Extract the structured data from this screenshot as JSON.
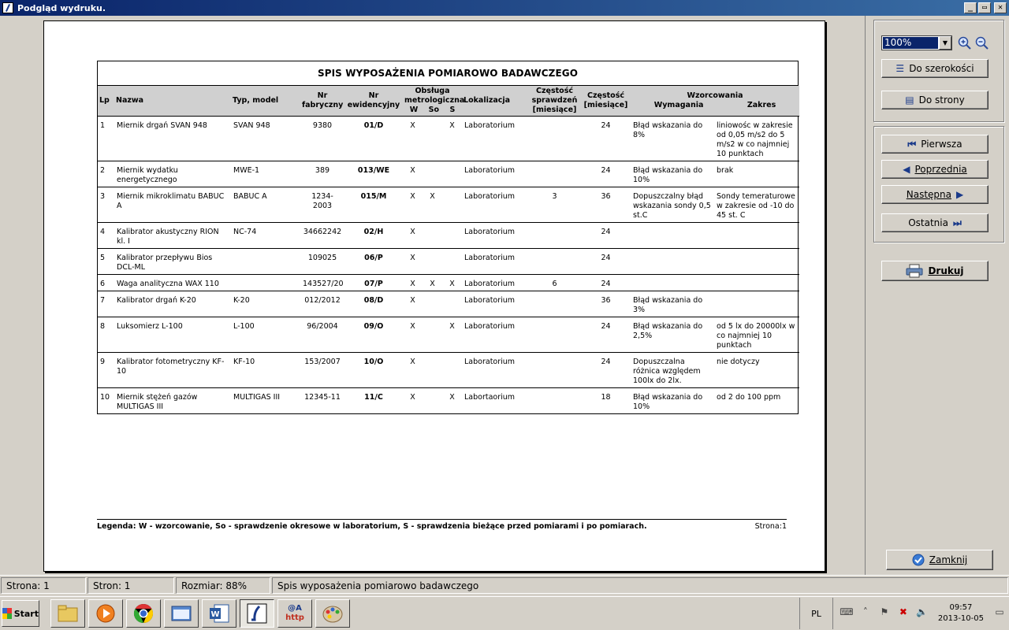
{
  "window": {
    "title": "Podgląd wydruku.",
    "buttons": [
      "_",
      "▭",
      "✕"
    ]
  },
  "report": {
    "title": "SPIS WYPOSAŻENIA POMIAROWO BADAWCZEGO",
    "headers": {
      "lp": "Lp",
      "nazwa": "Nazwa",
      "typ": "Typ, model",
      "nr_fab": "Nr fabryczny",
      "nr_ewid": "Nr ewidencyjny",
      "obsluga": "Obsługa metrologiczna",
      "obs_w": "W",
      "obs_so": "So",
      "obs_s": "S",
      "lokalizacja": "Lokalizacja",
      "czest_spr": "Częstość sprawdzeń [miesiące]",
      "czest": "Częstość [miesiące]",
      "wzorcowania": "Wzorcowania",
      "wymagania": "Wymagania",
      "zakres": "Zakres"
    },
    "rows": [
      {
        "lp": "1",
        "nazwa": "Miernik drgań SVAN 948",
        "typ": "SVAN 948",
        "nr_fab": "9380",
        "nr_ewid": "01/D",
        "w": "X",
        "so": "",
        "s": "X",
        "lok": "Laboratorium",
        "czest_spr": "",
        "czest": "24",
        "wym": "Błąd wskazania do 8%",
        "zakres": "liniowośc w zakresie od 0,05 m/s2 do 5 m/s2 w co najmniej 10 punktach"
      },
      {
        "lp": "2",
        "nazwa": "Miernik wydatku energetycznego",
        "typ": "MWE-1",
        "nr_fab": "389",
        "nr_ewid": "013/WE",
        "w": "X",
        "so": "",
        "s": "",
        "lok": "Laboratorium",
        "czest_spr": "",
        "czest": "24",
        "wym": "Błąd wskazania do 10%",
        "zakres": "brak"
      },
      {
        "lp": "3",
        "nazwa": "Miernik mikroklimatu BABUC A",
        "typ": "BABUC A",
        "nr_fab": "1234-2003",
        "nr_ewid": "015/M",
        "w": "X",
        "so": "X",
        "s": "",
        "lok": "Laboratorium",
        "czest_spr": "3",
        "czest": "36",
        "wym": "Dopuszczalny błąd wskazania sondy 0,5 st.C",
        "zakres": "Sondy temeraturowe w zakresie od -10 do 45 st. C"
      },
      {
        "lp": "4",
        "nazwa": "Kalibrator akustyczny RION kl. I",
        "typ": "NC-74",
        "nr_fab": "34662242",
        "nr_ewid": "02/H",
        "w": "X",
        "so": "",
        "s": "",
        "lok": "Laboratorium",
        "czest_spr": "",
        "czest": "24",
        "wym": "",
        "zakres": ""
      },
      {
        "lp": "5",
        "nazwa": "Kalibrator przepływu Bios DCL-ML",
        "typ": "",
        "nr_fab": "109025",
        "nr_ewid": "06/P",
        "w": "X",
        "so": "",
        "s": "",
        "lok": "Laboratorium",
        "czest_spr": "",
        "czest": "24",
        "wym": "",
        "zakres": ""
      },
      {
        "lp": "6",
        "nazwa": "Waga analityczna WAX 110",
        "typ": "",
        "nr_fab": "143527/20",
        "nr_ewid": "07/P",
        "w": "X",
        "so": "X",
        "s": "X",
        "lok": "Laboratorium",
        "czest_spr": "6",
        "czest": "24",
        "wym": "",
        "zakres": ""
      },
      {
        "lp": "7",
        "nazwa": "Kalibrator drgań K-20",
        "typ": "K-20",
        "nr_fab": "012/2012",
        "nr_ewid": "08/D",
        "w": "X",
        "so": "",
        "s": "",
        "lok": "Laboratorium",
        "czest_spr": "",
        "czest": "36",
        "wym": "Błąd wskazania do 3%",
        "zakres": ""
      },
      {
        "lp": "8",
        "nazwa": "Luksomierz L-100",
        "typ": "L-100",
        "nr_fab": "96/2004",
        "nr_ewid": "09/O",
        "w": "X",
        "so": "",
        "s": "X",
        "lok": "Laboratorium",
        "czest_spr": "",
        "czest": "24",
        "wym": "Błąd wskazania do 2,5%",
        "zakres": "od 5 lx do 20000lx w co najmniej 10 punktach"
      },
      {
        "lp": "9",
        "nazwa": "Kalibrator fotometryczny KF-10",
        "typ": "KF-10",
        "nr_fab": "153/2007",
        "nr_ewid": "10/O",
        "w": "X",
        "so": "",
        "s": "",
        "lok": "Laboratorium",
        "czest_spr": "",
        "czest": "24",
        "wym": "Dopuszczalna różnica względem 100lx do 2lx.",
        "zakres": "nie dotyczy"
      },
      {
        "lp": "10",
        "nazwa": "Miernik stężeń gazów MULTIGAS III",
        "typ": "MULTIGAS III",
        "nr_fab": "12345-11",
        "nr_ewid": "11/C",
        "w": "X",
        "so": "",
        "s": "X",
        "lok": "Labortaorium",
        "czest_spr": "",
        "czest": "18",
        "wym": "Błąd wskazania do 10%",
        "zakres": "od 2 do 100 ppm"
      }
    ],
    "legend": "Legenda: W - wzorcowanie, So - sprawdzenie okresowe w laboratorium, S - sprawdzenia bieżące przed pomiarami i po pomiarach.",
    "page_label": "Strona:1"
  },
  "panel": {
    "zoom_value": "100%",
    "fit_width": "Do szerokości",
    "fit_page": "Do strony",
    "first": "Pierwsza",
    "prev": "Poprzednia",
    "next": "Następna",
    "last": "Ostatnia",
    "print": "Drukuj",
    "close": "Zamknij"
  },
  "status": {
    "page": "Strona: 1",
    "pages": "Stron: 1",
    "size": "Rozmiar: 88%",
    "doc": "Spis wyposażenia pomiarowo badawczego"
  },
  "taskbar": {
    "start": "Start",
    "lang": "PL",
    "time": "09:57",
    "date": "2013-10-05",
    "email_http_top": "@A",
    "email_http_bottom": "http"
  }
}
